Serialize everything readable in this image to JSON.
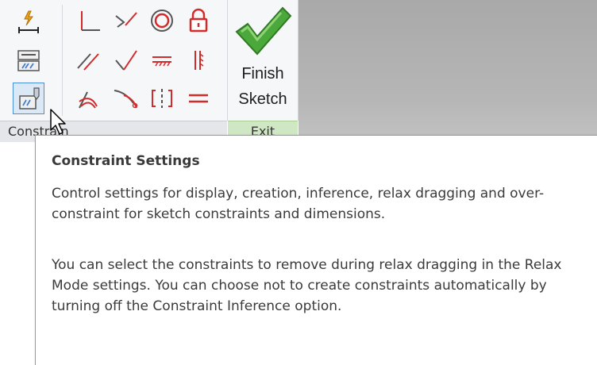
{
  "ribbon": {
    "constrain_panel": {
      "label": "Constrain",
      "tools": [
        {
          "name": "automatic-dimensions"
        },
        {
          "name": "show-constraints"
        },
        {
          "name": "constraint-settings"
        },
        {
          "name": "perpendicular"
        },
        {
          "name": "coincident"
        },
        {
          "name": "concentric"
        },
        {
          "name": "fix"
        },
        {
          "name": "parallel"
        },
        {
          "name": "tangent"
        },
        {
          "name": "horizontal"
        },
        {
          "name": "vertical"
        },
        {
          "name": "smooth"
        },
        {
          "name": "collinear"
        },
        {
          "name": "symmetric"
        },
        {
          "name": "equal"
        }
      ]
    },
    "exit_panel": {
      "label": "Exit",
      "finish_line1": "Finish",
      "finish_line2": "Sketch"
    }
  },
  "tooltip": {
    "title": "Constraint Settings",
    "paragraph1": "Control settings for display, creation, inference, relax dragging and over-constraint for sketch constraints and dimensions.",
    "paragraph2": "You can select the constraints to remove during relax dragging in the Relax Mode settings. You can choose not to create constraints automatically by turning off the Constraint Inference option."
  },
  "colors": {
    "constraint_red": "#d32a2a",
    "finish_green": "#3f9b2f",
    "tooltip_text": "#3a3a3a"
  }
}
